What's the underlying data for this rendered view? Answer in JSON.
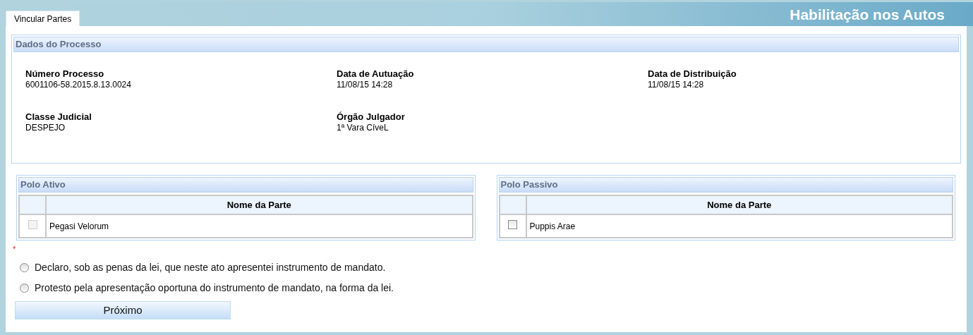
{
  "page_title": "Habilitação nos Autos",
  "tabs": [
    {
      "label": "Vincular Partes",
      "selected": true
    }
  ],
  "process": {
    "title": "Dados do Processo",
    "fields": [
      {
        "label": "Número Processo",
        "value": "6001106-58.2015.8.13.0024"
      },
      {
        "label": "Data de Autuação",
        "value": "11/08/15 14:28"
      },
      {
        "label": "Data de Distribuição",
        "value": "11/08/15 14:28"
      },
      {
        "label": "Classe Judicial",
        "value": "DESPEJO"
      },
      {
        "label": "Órgão Julgador",
        "value": "1ª Vara CíveL"
      }
    ]
  },
  "poles": [
    {
      "title": "Polo Ativo",
      "column": "Nome da Parte",
      "rows": [
        {
          "name": "Pegasi Velorum",
          "checked": false,
          "disabled": true
        }
      ]
    },
    {
      "title": "Polo Passivo",
      "column": "Nome da Parte",
      "rows": [
        {
          "name": "Puppis Arae",
          "checked": false,
          "disabled": false
        }
      ]
    }
  ],
  "required_mark": "*",
  "declarations": [
    {
      "label": "Declaro, sob as penas da lei, que neste ato apresentei instrumento de mandato.",
      "selected": false
    },
    {
      "label": "Protesto pela apresentação oportuna do instrumento de mandato, na forma da lei.",
      "selected": false
    }
  ],
  "next_button": "Próximo"
}
